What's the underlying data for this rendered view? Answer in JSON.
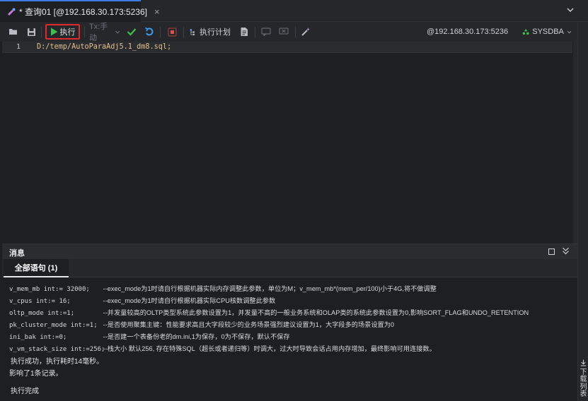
{
  "tab": {
    "title": "* 查询01 [@192.168.30.173:5236]",
    "close": "×"
  },
  "toolbar": {
    "run_label": "执行",
    "tx_label": "Tx:手动",
    "plan_label": "执行计划",
    "connection": "@192.168.30.173:5236",
    "user": "SYSDBA"
  },
  "editor": {
    "lines": [
      {
        "no": "1",
        "text": "D:/temp/AutoParaAdj5.1_dm8.sql;"
      }
    ]
  },
  "messages": {
    "header": "消息",
    "subtab": "全部语句 (1)",
    "rows": [
      {
        "code": "v_mem_mb int:= 32000;",
        "comment": "--exec_mode为1时请自行根据机器实际内存调整此参数，单位为M；v_mem_mb*(mem_per/100)小于4G,将不做调整"
      },
      {
        "code": "v_cpus int:= 16;",
        "comment": "--exec_mode为1时请自行根据机器实际CPU核数调整此参数"
      },
      {
        "code": "oltp_mode int:=1;",
        "comment": "--并发量较高的OLTP类型系统此参数设置为1，并发量不高的一般业务系统和OLAP类的系统此参数设置为0,影响SORT_FLAG和UNDO_RETENTION"
      },
      {
        "code": "pk_cluster_mode int:=1;",
        "comment": "--是否使用聚集主键：性能要求高且大字段较少的业务场景强烈建议设置为1，大字段多的场景设置为0"
      },
      {
        "code": "ini_bak int:=0;",
        "comment": "--是否建一个表备份老的dm.ini,1为保存，0为不保存，默认不保存"
      },
      {
        "code": "v_vm_stack_size int:=256;",
        "comment": "--栈大小 默认256, 存在特殊SQL（超长或者递归等）时调大，过大时导致会话占用内存增加，最终影响可用连接数。"
      }
    ],
    "result1": "执行成功，执行耗时14毫秒。",
    "result2": "影响了1条记录。",
    "done": "执行完成"
  },
  "side": {
    "download_list": "下载列表"
  },
  "colors": {
    "accent": "#3d7be0",
    "run_green": "#3fbf4f",
    "highlight_red": "#e02b2b",
    "code_yellow": "#e2c08d"
  }
}
